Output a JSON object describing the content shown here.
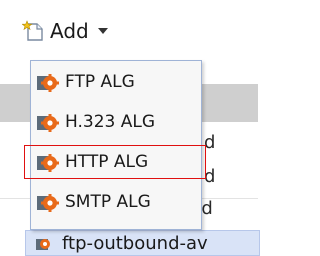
{
  "toolbar": {
    "add_label": "Add",
    "add_icon": "new-document-icon",
    "caret_icon": "chevron-down-icon"
  },
  "menu": {
    "items": [
      {
        "label": "FTP ALG",
        "icon": "alg-gear-icon"
      },
      {
        "label": "H.323 ALG",
        "icon": "alg-gear-icon"
      },
      {
        "label": "HTTP ALG",
        "icon": "alg-gear-icon"
      },
      {
        "label": "SMTP ALG",
        "icon": "alg-gear-icon"
      }
    ],
    "highlighted_index": 2,
    "highlight_color": "#e01010"
  },
  "background_list": {
    "fragments": [
      "d",
      "d",
      "nd"
    ],
    "selected_item_label": "ftp-outbound-av"
  },
  "colors": {
    "menu_border": "#9fb3d6",
    "icon_orange": "#e86a1a"
  }
}
